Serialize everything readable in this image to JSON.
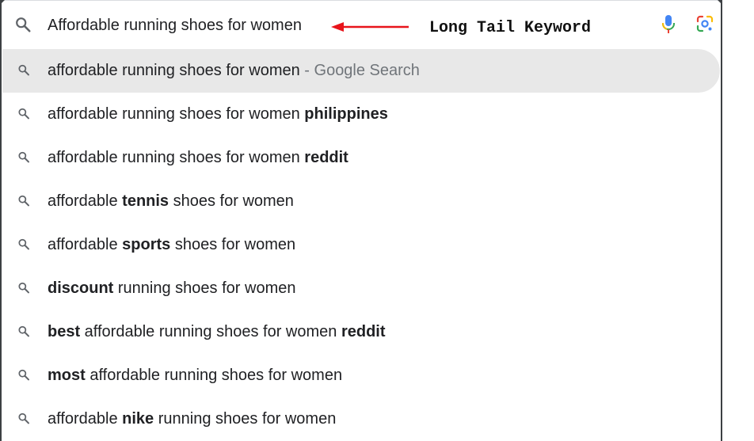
{
  "search": {
    "query": "Affordable running shoes for women"
  },
  "annotation": {
    "label": "Long Tail Keyword",
    "arrow_color": "#e8141b"
  },
  "colors": {
    "highlight_bg": "#e8e8e8",
    "text": "#202124",
    "muted": "#70757a"
  },
  "icons": {
    "search": "search-icon",
    "mic": "microphone-icon",
    "lens": "google-lens-icon"
  },
  "suggestions": [
    {
      "parts": [
        {
          "t": "affordable running shoes for women",
          "b": false
        }
      ],
      "suffix": " - Google Search",
      "highlighted": true
    },
    {
      "parts": [
        {
          "t": "affordable running shoes for women ",
          "b": false
        },
        {
          "t": "philippines",
          "b": true
        }
      ]
    },
    {
      "parts": [
        {
          "t": "affordable running shoes for women ",
          "b": false
        },
        {
          "t": "reddit",
          "b": true
        }
      ]
    },
    {
      "parts": [
        {
          "t": "affordable ",
          "b": false
        },
        {
          "t": "tennis",
          "b": true
        },
        {
          "t": " shoes for women",
          "b": false
        }
      ]
    },
    {
      "parts": [
        {
          "t": "affordable ",
          "b": false
        },
        {
          "t": "sports",
          "b": true
        },
        {
          "t": " shoes for women",
          "b": false
        }
      ]
    },
    {
      "parts": [
        {
          "t": "discount",
          "b": true
        },
        {
          "t": " running shoes for women",
          "b": false
        }
      ]
    },
    {
      "parts": [
        {
          "t": "best",
          "b": true
        },
        {
          "t": " affordable running shoes for women ",
          "b": false
        },
        {
          "t": "reddit",
          "b": true
        }
      ]
    },
    {
      "parts": [
        {
          "t": "most",
          "b": true
        },
        {
          "t": " affordable running shoes for women",
          "b": false
        }
      ]
    },
    {
      "parts": [
        {
          "t": "affordable ",
          "b": false
        },
        {
          "t": "nike",
          "b": true
        },
        {
          "t": " running shoes for women",
          "b": false
        }
      ]
    }
  ]
}
